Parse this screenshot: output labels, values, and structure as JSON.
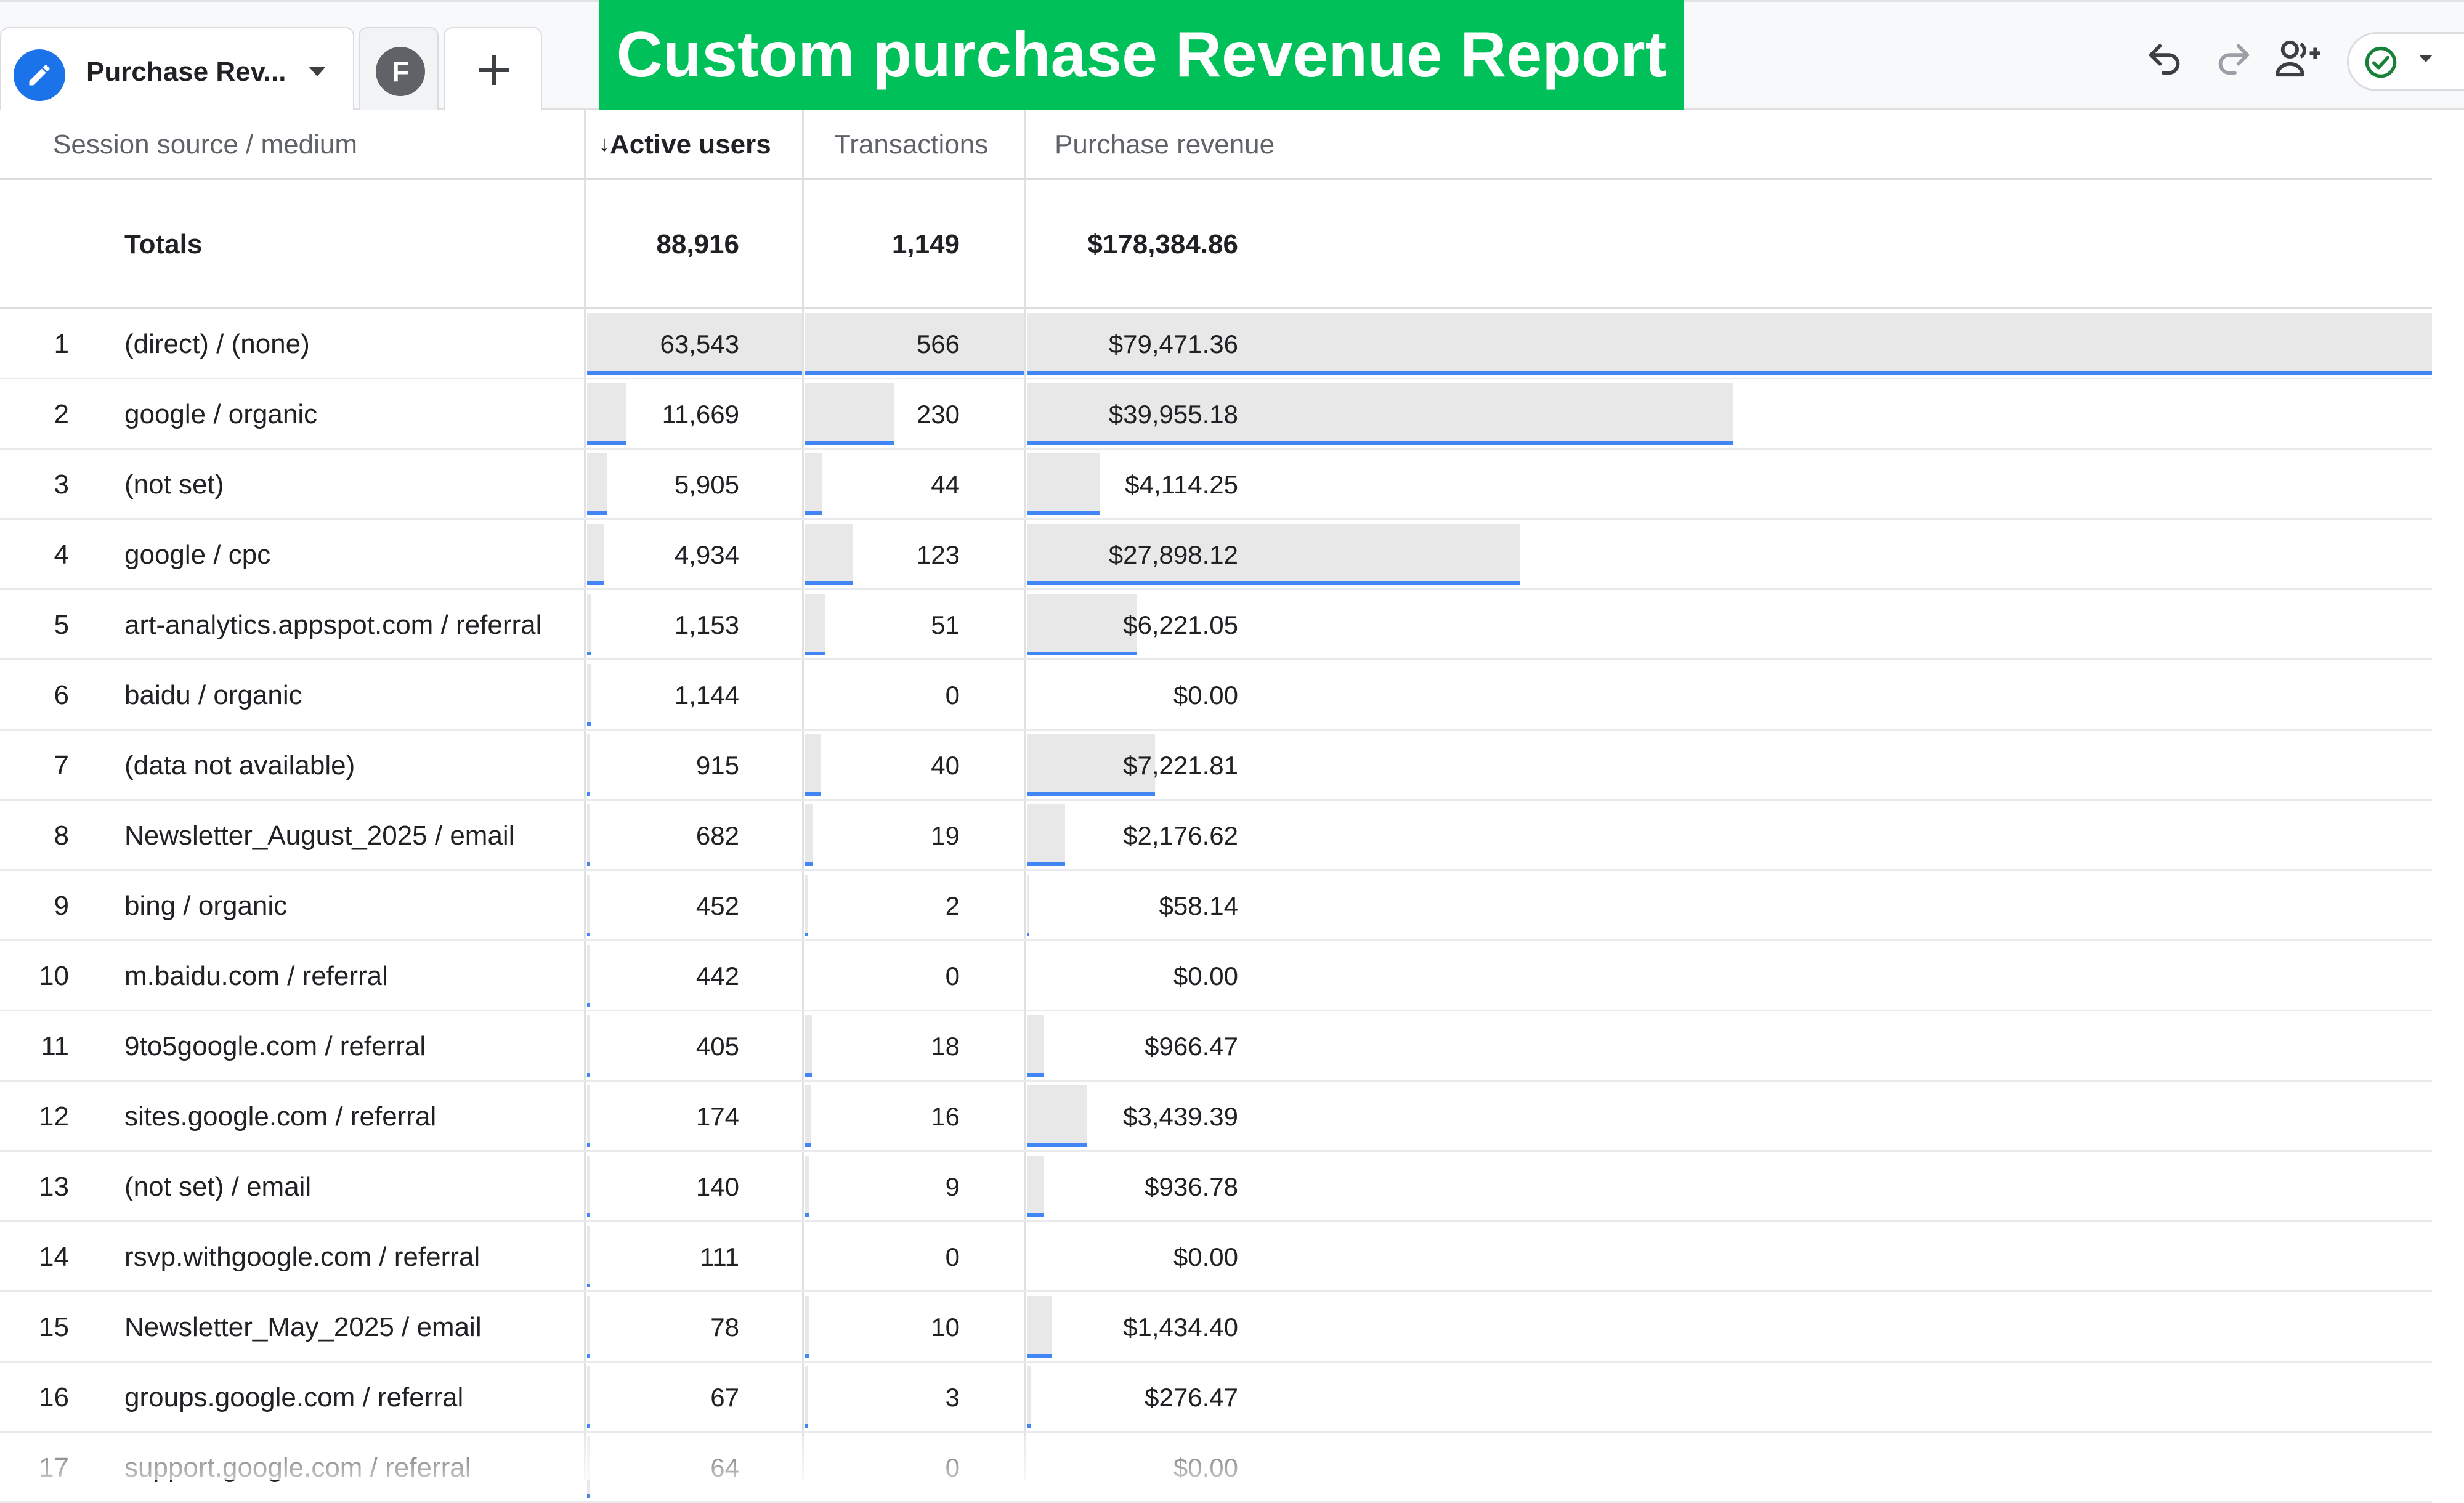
{
  "tabs": {
    "active_label": "Purchase Rev...",
    "avatar_letter": "F"
  },
  "banner": "Custom purchase Revenue Report",
  "table": {
    "columns": [
      "Session source / medium",
      "Active users",
      "Transactions",
      "Purchase revenue"
    ],
    "totals": {
      "label": "Totals",
      "active_users": "88,916",
      "transactions": "1,149",
      "revenue": "$178,384.86"
    },
    "rows": [
      {
        "n": "1",
        "source": "(direct) / (none)",
        "users": "63,543",
        "trans": "566",
        "revenue": "$79,471.36",
        "users_frac": 1.0,
        "trans_frac": 1.0,
        "rev_frac": 1.0
      },
      {
        "n": "2",
        "source": "google / organic",
        "users": "11,669",
        "trans": "230",
        "revenue": "$39,955.18",
        "users_frac": 0.184,
        "trans_frac": 0.406,
        "rev_frac": 0.503
      },
      {
        "n": "3",
        "source": "(not set)",
        "users": "5,905",
        "trans": "44",
        "revenue": "$4,114.25",
        "users_frac": 0.093,
        "trans_frac": 0.078,
        "rev_frac": 0.052
      },
      {
        "n": "4",
        "source": "google / cpc",
        "users": "4,934",
        "trans": "123",
        "revenue": "$27,898.12",
        "users_frac": 0.078,
        "trans_frac": 0.217,
        "rev_frac": 0.351
      },
      {
        "n": "5",
        "source": "art-analytics.appspot.com / referral",
        "users": "1,153",
        "trans": "51",
        "revenue": "$6,221.05",
        "users_frac": 0.018,
        "trans_frac": 0.09,
        "rev_frac": 0.078
      },
      {
        "n": "6",
        "source": "baidu / organic",
        "users": "1,144",
        "trans": "0",
        "revenue": "$0.00",
        "users_frac": 0.018,
        "trans_frac": 0,
        "rev_frac": 0
      },
      {
        "n": "7",
        "source": "(data not available)",
        "users": "915",
        "trans": "40",
        "revenue": "$7,221.81",
        "users_frac": 0.014,
        "trans_frac": 0.071,
        "rev_frac": 0.091
      },
      {
        "n": "8",
        "source": "Newsletter_August_2025 / email",
        "users": "682",
        "trans": "19",
        "revenue": "$2,176.62",
        "users_frac": 0.011,
        "trans_frac": 0.034,
        "rev_frac": 0.027
      },
      {
        "n": "9",
        "source": "bing / organic",
        "users": "452",
        "trans": "2",
        "revenue": "$58.14",
        "users_frac": 0.007,
        "trans_frac": 0.004,
        "rev_frac": 0.001
      },
      {
        "n": "10",
        "source": "m.baidu.com / referral",
        "users": "442",
        "trans": "0",
        "revenue": "$0.00",
        "users_frac": 0.007,
        "trans_frac": 0,
        "rev_frac": 0
      },
      {
        "n": "11",
        "source": "9to5google.com / referral",
        "users": "405",
        "trans": "18",
        "revenue": "$966.47",
        "users_frac": 0.006,
        "trans_frac": 0.032,
        "rev_frac": 0.012
      },
      {
        "n": "12",
        "source": "sites.google.com / referral",
        "users": "174",
        "trans": "16",
        "revenue": "$3,439.39",
        "users_frac": 0.003,
        "trans_frac": 0.028,
        "rev_frac": 0.043
      },
      {
        "n": "13",
        "source": "(not set) / email",
        "users": "140",
        "trans": "9",
        "revenue": "$936.78",
        "users_frac": 0.002,
        "trans_frac": 0.016,
        "rev_frac": 0.012
      },
      {
        "n": "14",
        "source": "rsvp.withgoogle.com / referral",
        "users": "111",
        "trans": "0",
        "revenue": "$0.00",
        "users_frac": 0.002,
        "trans_frac": 0,
        "rev_frac": 0
      },
      {
        "n": "15",
        "source": "Newsletter_May_2025 / email",
        "users": "78",
        "trans": "10",
        "revenue": "$1,434.40",
        "users_frac": 0.001,
        "trans_frac": 0.018,
        "rev_frac": 0.018
      },
      {
        "n": "16",
        "source": "groups.google.com / referral",
        "users": "67",
        "trans": "3",
        "revenue": "$276.47",
        "users_frac": 0.001,
        "trans_frac": 0.005,
        "rev_frac": 0.003
      },
      {
        "n": "17",
        "source": "support.google.com / referral",
        "users": "64",
        "trans": "0",
        "revenue": "$0.00",
        "users_frac": 0.001,
        "trans_frac": 0,
        "rev_frac": 0
      }
    ]
  },
  "colors": {
    "banner": "#00c05a",
    "accent_blue": "#4285f4",
    "bar_fill": "#e8e8e8"
  },
  "icons": [
    "pencil-icon",
    "caret-down-icon",
    "plus-icon",
    "undo-icon",
    "redo-icon",
    "share-users-icon",
    "check-circle-icon"
  ]
}
